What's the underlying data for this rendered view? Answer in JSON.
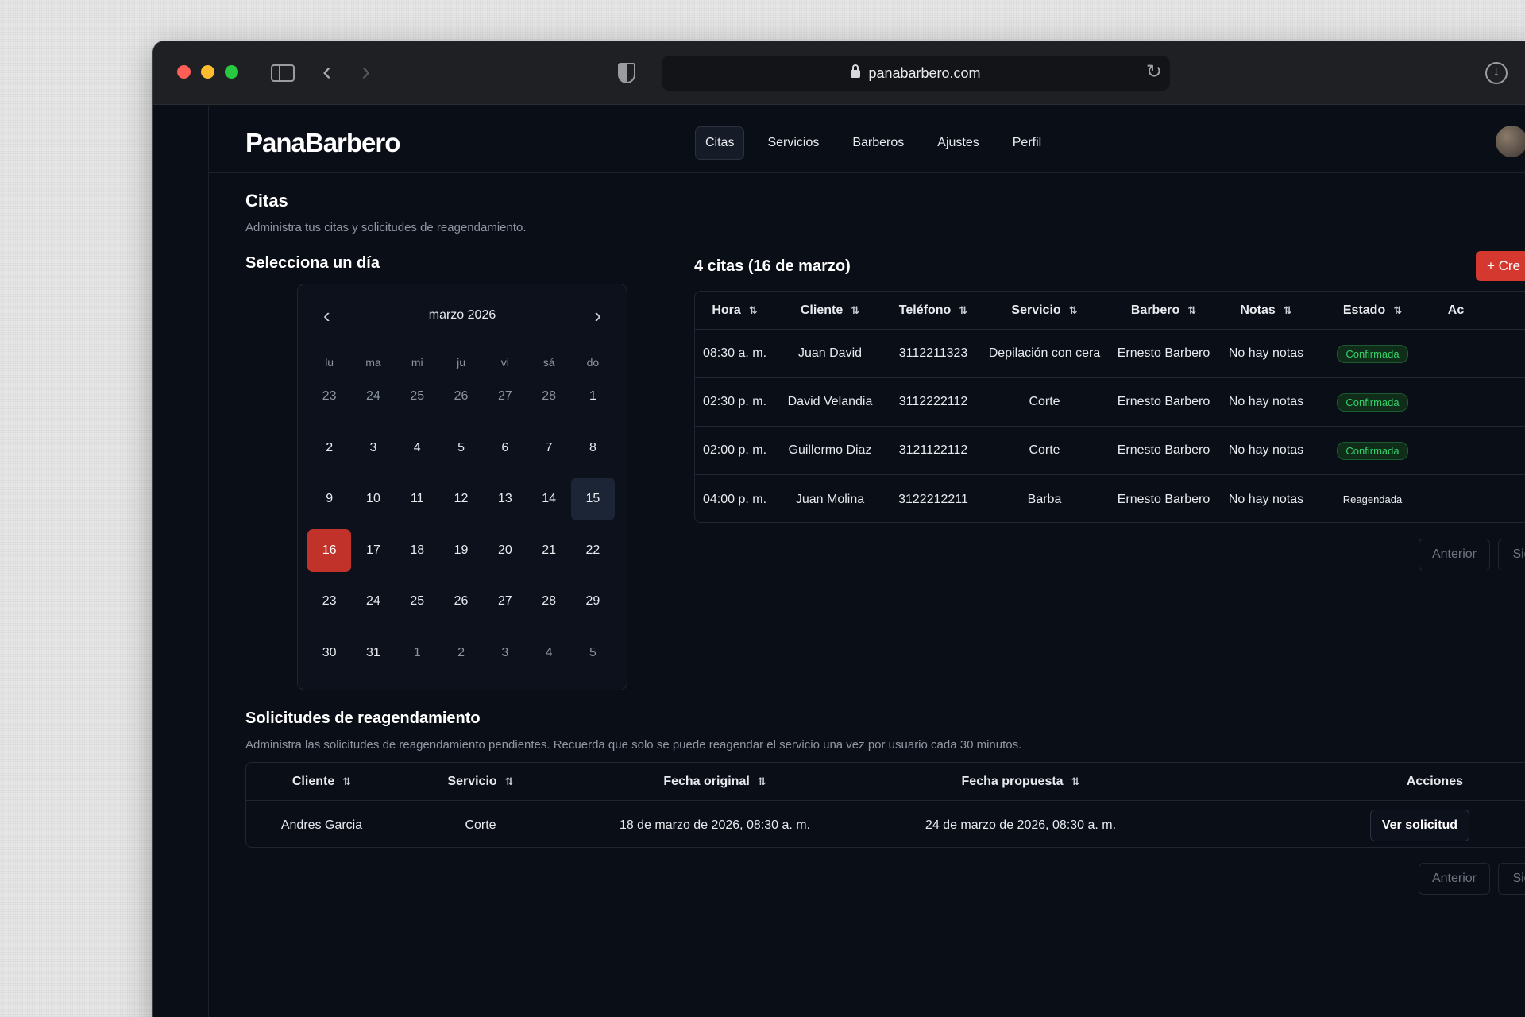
{
  "browser": {
    "url": "panabarbero.com"
  },
  "app": {
    "logo": "PanaBarbero",
    "nav": [
      {
        "label": "Citas",
        "active": true
      },
      {
        "label": "Servicios"
      },
      {
        "label": "Barberos"
      },
      {
        "label": "Ajustes"
      },
      {
        "label": "Perfil"
      }
    ]
  },
  "page": {
    "title": "Citas",
    "subtitle": "Administra tus citas y solicitudes de reagendamiento.",
    "select_day": "Selecciona un día"
  },
  "calendar": {
    "month": "marzo 2026",
    "weekdays": [
      "lu",
      "ma",
      "mi",
      "ju",
      "vi",
      "sá",
      "do"
    ],
    "days": [
      {
        "d": "23",
        "out": true
      },
      {
        "d": "24",
        "out": true
      },
      {
        "d": "25",
        "out": true
      },
      {
        "d": "26",
        "out": true
      },
      {
        "d": "27",
        "out": true
      },
      {
        "d": "28",
        "out": true
      },
      {
        "d": "1"
      },
      {
        "d": "2"
      },
      {
        "d": "3"
      },
      {
        "d": "4"
      },
      {
        "d": "5"
      },
      {
        "d": "6"
      },
      {
        "d": "7"
      },
      {
        "d": "8"
      },
      {
        "d": "9"
      },
      {
        "d": "10"
      },
      {
        "d": "11"
      },
      {
        "d": "12"
      },
      {
        "d": "13"
      },
      {
        "d": "14"
      },
      {
        "d": "15",
        "today": true
      },
      {
        "d": "16",
        "selected": true
      },
      {
        "d": "17"
      },
      {
        "d": "18"
      },
      {
        "d": "19"
      },
      {
        "d": "20"
      },
      {
        "d": "21"
      },
      {
        "d": "22"
      },
      {
        "d": "23"
      },
      {
        "d": "24"
      },
      {
        "d": "25"
      },
      {
        "d": "26"
      },
      {
        "d": "27"
      },
      {
        "d": "28"
      },
      {
        "d": "29"
      },
      {
        "d": "30"
      },
      {
        "d": "31"
      },
      {
        "d": "1",
        "out": true
      },
      {
        "d": "2",
        "out": true
      },
      {
        "d": "3",
        "out": true
      },
      {
        "d": "4",
        "out": true
      },
      {
        "d": "5",
        "out": true
      }
    ]
  },
  "appointments": {
    "heading": "4 citas (16 de marzo)",
    "create_label": "Cre",
    "columns": [
      "Hora",
      "Cliente",
      "Teléfono",
      "Servicio",
      "Barbero",
      "Notas",
      "Estado",
      "Ac"
    ],
    "rows": [
      {
        "hora": "08:30 a. m.",
        "cliente": "Juan David",
        "telefono": "3112211323",
        "servicio": "Depilación con cera",
        "barbero": "Ernesto Barbero",
        "notas": "No hay notas",
        "estado": "Confirmada",
        "tone": "ok"
      },
      {
        "hora": "02:30 p. m.",
        "cliente": "David Velandia",
        "telefono": "3112222112",
        "servicio": "Corte",
        "barbero": "Ernesto Barbero",
        "notas": "No hay notas",
        "estado": "Confirmada",
        "tone": "ok"
      },
      {
        "hora": "02:00 p. m.",
        "cliente": "Guillermo Diaz",
        "telefono": "3121122112",
        "servicio": "Corte",
        "barbero": "Ernesto Barbero",
        "notas": "No hay notas",
        "estado": "Confirmada",
        "tone": "ok"
      },
      {
        "hora": "04:00 p. m.",
        "cliente": "Juan Molina",
        "telefono": "3122212211",
        "servicio": "Barba",
        "barbero": "Ernesto Barbero",
        "notas": "No hay notas",
        "estado": "Reagendada",
        "tone": "re"
      }
    ],
    "prev": "Anterior",
    "next": "Sig"
  },
  "requests": {
    "heading": "Solicitudes de reagendamiento",
    "subtitle": "Administra las solicitudes de reagendamiento pendientes. Recuerda que solo se puede reagendar el servicio una vez por usuario cada 30 minutos.",
    "columns": [
      "Cliente",
      "Servicio",
      "Fecha original",
      "Fecha propuesta",
      "Acciones"
    ],
    "rows": [
      {
        "cliente": "Andres Garcia",
        "servicio": "Corte",
        "fecha_original": "18 de marzo de 2026, 08:30 a. m.",
        "fecha_propuesta": "24 de marzo de 2026, 08:30 a. m.",
        "accion": "Ver solicitud"
      }
    ],
    "prev": "Anterior",
    "next": "Sig"
  },
  "colors": {
    "accent": "#d5382f",
    "background": "#0a0e17",
    "confirmed": "#36d06a"
  }
}
